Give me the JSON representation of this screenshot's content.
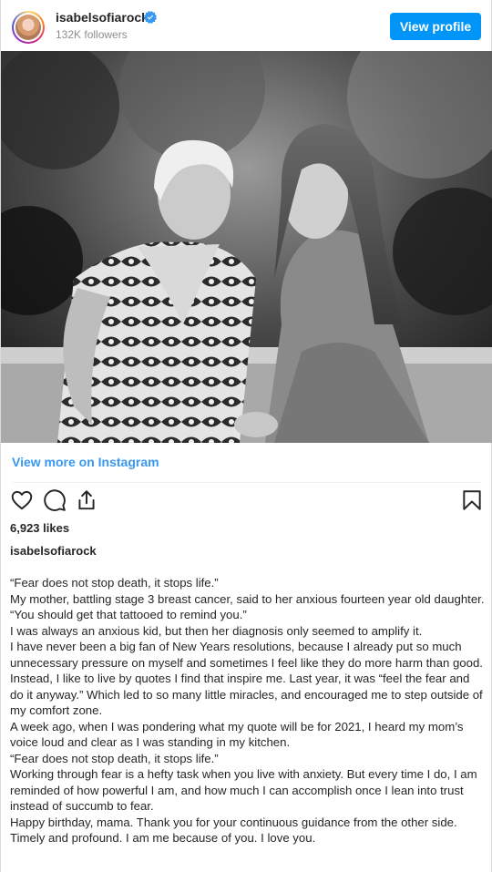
{
  "header": {
    "username": "isabelsofiarock",
    "followers": "132K followers",
    "view_profile_label": "View profile",
    "verified_icon": "verified-badge-icon"
  },
  "link": {
    "view_more": "View more on Instagram"
  },
  "actions": {
    "icons": [
      "heart-icon",
      "comment-icon",
      "share-icon",
      "bookmark-icon"
    ]
  },
  "post": {
    "likes": "6,923 likes",
    "caption_username": "isabelsofiarock",
    "caption_lines": [
      "“Fear does not stop death, it stops life.”",
      "My mother, battling stage 3 breast cancer, said to her anxious fourteen year old daughter.",
      "“You should get that tattooed to remind you.”",
      "I was always an anxious kid, but then her diagnosis only seemed to amplify it.",
      "I have never been a big fan of New Years resolutions, because I already put so much unnecessary pressure on myself and sometimes I feel like they do more harm than good. Instead, I like to live by quotes I find that inspire me. Last year, it was “feel the fear and do it anyway.” Which led to so many little miracles, and encouraged me to step outside of my comfort zone.",
      "A week ago, when I was pondering what my quote will be for 2021, I heard my mom’s voice loud and clear as I was standing in my kitchen.",
      "“Fear does not stop death, it stops life.”",
      "Working through fear is a hefty task when you live with anxiety. But every time I do, I am reminded of how powerful I am, and how much I can accomplish once I lean into trust instead of succumb to fear.",
      "Happy birthday, mama. Thank you for your continuous guidance from the other side. Timely and profound. I am me because of you. I love you."
    ]
  },
  "colors": {
    "accent": "#0095f6",
    "link": "#3897f0",
    "text": "#262626",
    "muted": "#8e8e8e"
  }
}
